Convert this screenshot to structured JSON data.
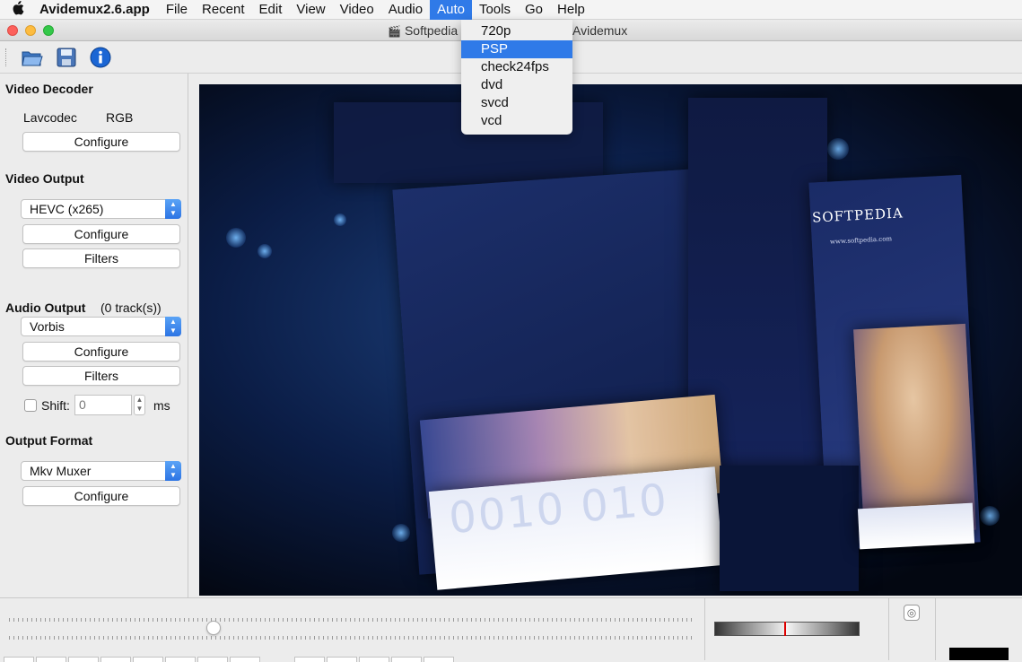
{
  "menubar": {
    "apple": "",
    "app_name": "Avidemux2.6.app",
    "items": [
      "File",
      "Recent",
      "Edit",
      "View",
      "Video",
      "Audio",
      "Auto",
      "Tools",
      "Go",
      "Help"
    ],
    "active": "Auto"
  },
  "auto_menu": {
    "items": [
      "720p",
      "PSP",
      "check24fps",
      "dvd",
      "svcd",
      "vcd"
    ],
    "highlighted": "PSP"
  },
  "window": {
    "title_left": "Softpedia",
    "title_right": "Avidemux"
  },
  "toolbar": {
    "icons": [
      "open-folder-icon",
      "save-disk-icon",
      "info-icon"
    ]
  },
  "video_decoder": {
    "heading": "Video Decoder",
    "codec": "Lavcodec",
    "format": "RGB",
    "configure_label": "Configure"
  },
  "video_output": {
    "heading": "Video Output",
    "selected": "HEVC (x265)",
    "configure_label": "Configure",
    "filters_label": "Filters"
  },
  "audio_output": {
    "heading": "Audio Output",
    "tracks": "(0 track(s))",
    "selected": "Vorbis",
    "configure_label": "Configure",
    "filters_label": "Filters",
    "shift_label": "Shift:",
    "shift_value": "0",
    "unit": "ms"
  },
  "output_format": {
    "heading": "Output Format",
    "selected": "Mkv Muxer",
    "configure_label": "Configure"
  },
  "preview": {
    "logo": "SOFTPEDIA",
    "url": "www.softpedia.com",
    "zeros": "0010 010"
  },
  "colors": {
    "accent": "#2f7ae8",
    "volume_marker": "#dd0000"
  }
}
